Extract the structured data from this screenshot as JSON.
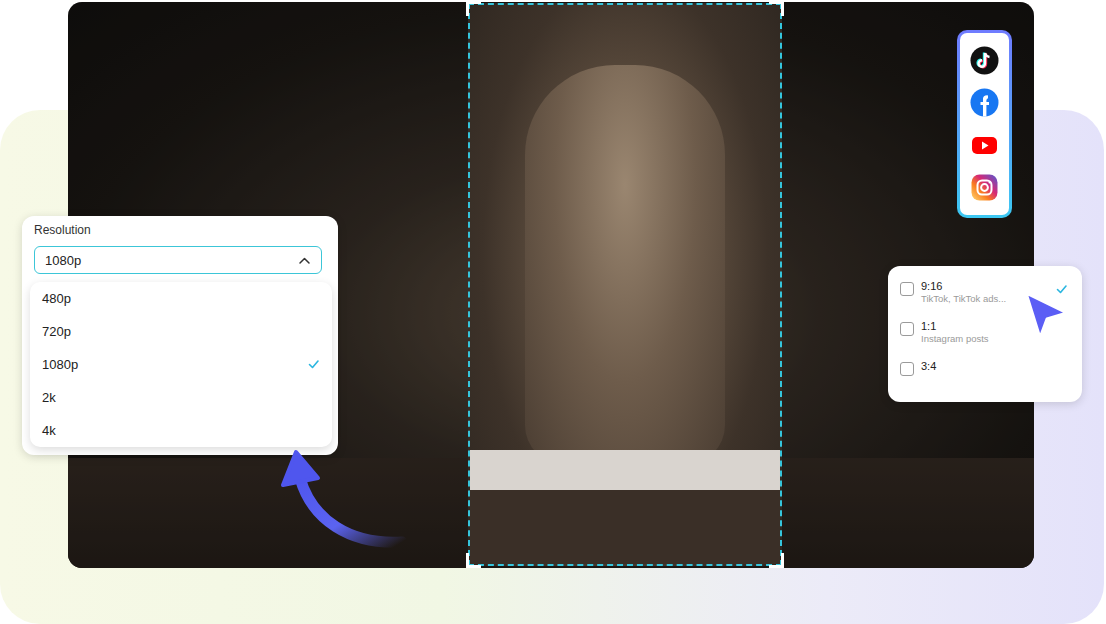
{
  "platforms": [
    {
      "kind": "tiktok"
    },
    {
      "kind": "facebook"
    },
    {
      "kind": "youtube"
    },
    {
      "kind": "instagram"
    }
  ],
  "resolution": {
    "label": "Resolution",
    "value": "1080p",
    "options": [
      {
        "label": "480p",
        "selected": false
      },
      {
        "label": "720p",
        "selected": false
      },
      {
        "label": "1080p",
        "selected": true
      },
      {
        "label": "2k",
        "selected": false
      },
      {
        "label": "4k",
        "selected": false
      }
    ]
  },
  "aspect_ratios": [
    {
      "label": "9:16",
      "description": "TikTok, TikTok ads...",
      "selected": true
    },
    {
      "label": "1:1",
      "description": "Instagram posts",
      "selected": false
    },
    {
      "label": "3:4",
      "description": "",
      "selected": false
    }
  ]
}
